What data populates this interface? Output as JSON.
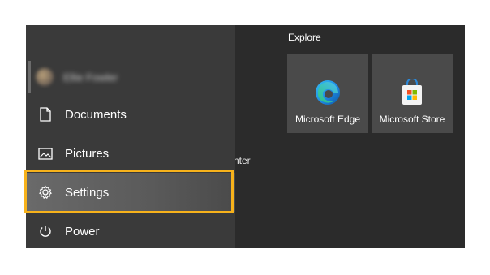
{
  "sidebar": {
    "user": {
      "name": "Ellie Fowler"
    },
    "items": [
      {
        "label": "Documents",
        "icon": "document-icon"
      },
      {
        "label": "Pictures",
        "icon": "pictures-icon"
      },
      {
        "label": "Settings",
        "icon": "gear-icon"
      },
      {
        "label": "Power",
        "icon": "power-icon"
      }
    ]
  },
  "background_text": "nter",
  "explore": {
    "title": "Explore",
    "tiles": [
      {
        "label": "Microsoft Edge",
        "icon": "edge-icon"
      },
      {
        "label": "Microsoft Store",
        "icon": "store-icon"
      }
    ]
  },
  "colors": {
    "highlight": "#f7b21b",
    "menu_bg": "#2f2f2f",
    "tile_bg": "#4a4a4a"
  }
}
